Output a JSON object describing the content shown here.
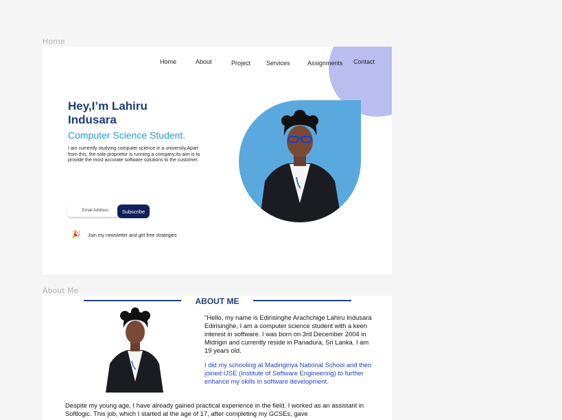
{
  "frames": {
    "home_label": "Home",
    "about_label": "About Me"
  },
  "nav": {
    "items": [
      "Home",
      "About",
      "Project",
      "Services",
      "Assignments",
      "Contact"
    ]
  },
  "hero": {
    "name": "Hey,I’m Lahiru Indusara",
    "role": "Computer Science Student.",
    "description": "I am currently studying computer science in a university.Apart from this, the sole proprietor is running a company.Its aim is to provide the most accurate software solutions to the customer.",
    "email_placeholder": "Email Address",
    "subscribe_label": "Subscribe",
    "newsletter_text": "Join my newsletter and get free strategies",
    "newsletter_icon": "party-popper-icon"
  },
  "about": {
    "title": "ABOUT ME",
    "paragraph1": "\"Hello, my name is Edirisinghe Arachchige Lahiru Indusara Edirisinghe, I am a computer science student with a keen interest in software. I was born on 3rd December 2004 in Midrigiri and currently reside in Panadura, Sri Lanka. I am 19 years old.",
    "paragraph2": "I did my schooling at Madirigiriya National School and then joined IJSE (Institute of Software Engineering) to further enhance my skills in software development.",
    "paragraph3": "Despite my young age, I have already gained practical experience in the field. I worked as an assistant in Softlogic. This job, which I started at the age of 17, after completing my GCSEs, gave"
  },
  "colors": {
    "accent_dark": "#1d3c7a",
    "accent_light": "#2696d8",
    "blob": "#b9bdf0",
    "portrait_bg": "#5aa9de",
    "button": "#12215c"
  }
}
